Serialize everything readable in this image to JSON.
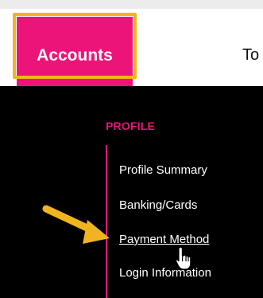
{
  "nav": {
    "accounts_label": "Accounts",
    "next_tab_label": "To",
    "active_color": "#ec1479",
    "highlight_color": "#f1b421"
  },
  "profile_menu": {
    "heading": "PROFILE",
    "items": [
      {
        "label": "Profile Summary"
      },
      {
        "label": "Banking/Cards"
      },
      {
        "label": "Payment Method",
        "state": "hovered"
      },
      {
        "label": "Login Information"
      }
    ]
  },
  "annotation": {
    "arrow_icon": "arrow-pointer-icon",
    "cursor_icon": "hand-cursor-icon",
    "arrow_color": "#f1b421"
  }
}
